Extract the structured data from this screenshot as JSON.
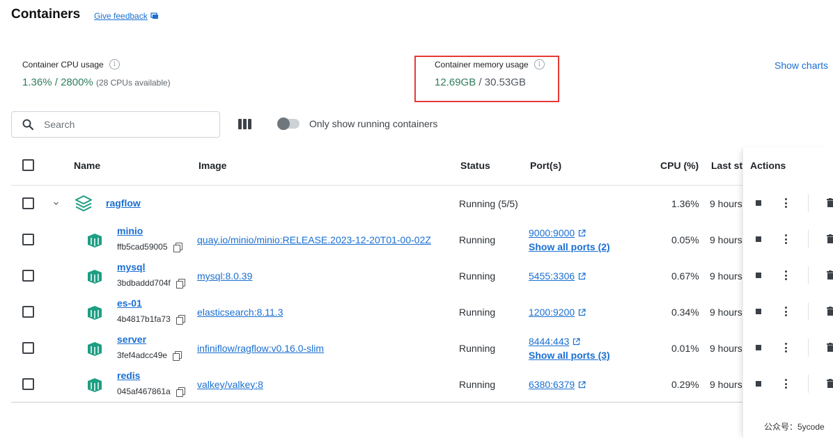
{
  "page": {
    "title": "Containers",
    "feedback": "Give feedback"
  },
  "stats": {
    "cpu_label": "Container CPU usage",
    "cpu_used": "1.36%",
    "cpu_sep": " / ",
    "cpu_total": "2800%",
    "cpu_note": "(28 CPUs available)",
    "mem_label": "Container memory usage",
    "mem_used": "12.69GB",
    "mem_sep": " / ",
    "mem_total": "30.53GB",
    "show_charts": "Show charts"
  },
  "toolbar": {
    "search_placeholder": "Search",
    "toggle_label": "Only show running containers"
  },
  "table": {
    "headers": {
      "name": "Name",
      "image": "Image",
      "status": "Status",
      "ports": "Port(s)",
      "cpu": "CPU (%)",
      "last_started": "Last sta",
      "actions": "Actions"
    },
    "group": {
      "name": "ragflow",
      "status": "Running (5/5)",
      "cpu": "1.36%",
      "last": "9 hours"
    },
    "rows": [
      {
        "name": "minio",
        "id": "ffb5cad59005",
        "image": "quay.io/minio/minio:RELEASE.2023-12-20T01-00-02Z",
        "status": "Running",
        "port": "9000:9000",
        "show_all": "Show all ports (2)",
        "cpu": "0.05%",
        "last": "9 hours"
      },
      {
        "name": "mysql",
        "id": "3bdbaddd704f",
        "image": "mysql:8.0.39",
        "status": "Running",
        "port": "5455:3306",
        "show_all": "",
        "cpu": "0.67%",
        "last": "9 hours"
      },
      {
        "name": "es-01",
        "id": "4b4817b1fa73",
        "image": "elasticsearch:8.11.3",
        "status": "Running",
        "port": "1200:9200",
        "show_all": "",
        "cpu": "0.34%",
        "last": "9 hours"
      },
      {
        "name": "server",
        "id": "3fef4adcc49e",
        "image": "infiniflow/ragflow:v0.16.0-slim",
        "status": "Running",
        "port": "8444:443",
        "show_all": "Show all ports (3)",
        "cpu": "0.01%",
        "last": "9 hours"
      },
      {
        "name": "redis",
        "id": "045af467861a",
        "image": "valkey/valkey:8",
        "status": "Running",
        "port": "6380:6379",
        "show_all": "",
        "cpu": "0.29%",
        "last": "9 hours"
      }
    ]
  },
  "watermark": "公众号：5ycode",
  "colors": {
    "accent": "#1a6fd1",
    "green": "#2e7d5b",
    "container_icon": "#1e9e82",
    "highlight": "#e53935"
  }
}
